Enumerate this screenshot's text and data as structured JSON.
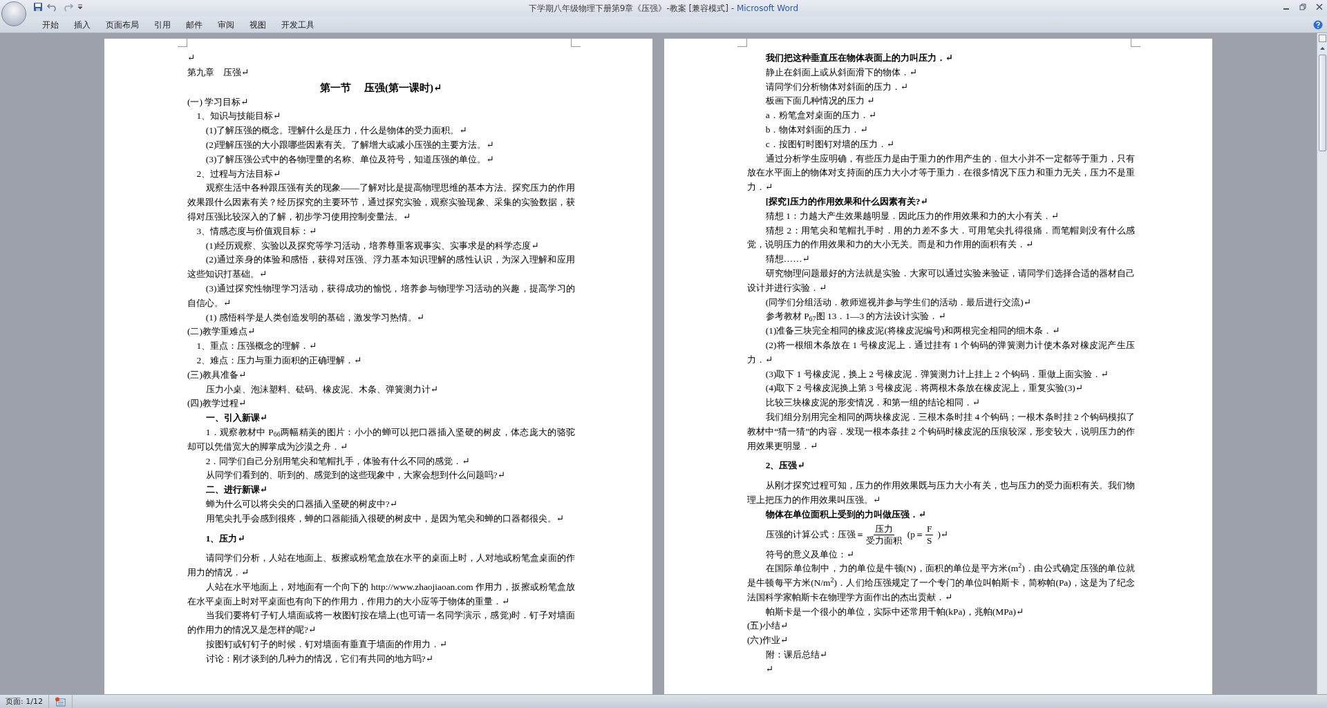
{
  "window": {
    "title": "下学期八年级物理下册第9章《压强》-教案 [兼容模式] - ",
    "app": "Microsoft Word"
  },
  "ribbon_tabs": [
    {
      "label": "开始"
    },
    {
      "label": "插入"
    },
    {
      "label": "页面布局"
    },
    {
      "label": "引用"
    },
    {
      "label": "邮件"
    },
    {
      "label": "审阅"
    },
    {
      "label": "视图"
    },
    {
      "label": "开发工具"
    }
  ],
  "pages": [
    {
      "paragraphs": [
        {
          "kind": "flush",
          "text": "↵"
        },
        {
          "kind": "flush",
          "text": "第九章　压强↵"
        },
        {
          "kind": "title",
          "text": "第一节　 压强(第一课时)↵"
        },
        {
          "kind": "flush",
          "text": "(一) 学习目标↵"
        },
        {
          "kind": "indent1",
          "text": "1、知识与技能目标↵"
        },
        {
          "kind": "indent2",
          "text": "(1)了解压强的概念。理解什么是压力，什么是物体的受力面积。↵"
        },
        {
          "kind": "indent2",
          "text": "(2)理解压强的大小跟哪些因素有关。了解增大或减小压强的主要方法。↵"
        },
        {
          "kind": "indent2",
          "text": "(3)了解压强公式中的各物理量的名称、单位及符号，知道压强的单位。↵"
        },
        {
          "kind": "indent1",
          "text": "2、过程与方法目标↵"
        },
        {
          "kind": "indent2",
          "text": "观察生活中各种跟压强有关的现象——了解对比是提高物理思维的基本方法。探究压力的作用效果跟什么因素有关？经历探究的主要环节，通过探究实验，观察实验现象、采集的实验数据，获得对压强比较深入的了解，初步学习使用控制变量法。↵"
        },
        {
          "kind": "indent1",
          "text": "3、情感态度与价值观目标：↵"
        },
        {
          "kind": "indent2",
          "text": "(1)经历观察、实验以及探究等学习活动，培养尊重客观事实、实事求是的科学态度↵"
        },
        {
          "kind": "indent2",
          "text": "(2)通过亲身的体验和感悟，获得对压强、浮力基本知识理解的感性认识，为深入理解和应用这些知识打基础。↵"
        },
        {
          "kind": "indent2",
          "text": "(3)通过探究性物理学习活动，获得成功的愉悦，培养参与物理学习活动的兴趣，提高学习的自信心。↵"
        },
        {
          "kind": "indent2",
          "text": "(1) 感悟科学是人类创造发明的基础，激发学习热情。↵"
        },
        {
          "kind": "flush",
          "text": "(二)教学重难点↵"
        },
        {
          "kind": "indent1",
          "text": "1、重点：压强概念的理解．↵"
        },
        {
          "kind": "indent1",
          "text": "2、难点：压力与重力面积的正确理解．↵"
        },
        {
          "kind": "flush",
          "text": "(三)教具准备↵"
        },
        {
          "kind": "indent2",
          "text": "压力小桌、泡沫塑料、砝码、橡皮泥、木条、弹簧测力计↵"
        },
        {
          "kind": "flush",
          "text": "(四)教学过程↵"
        },
        {
          "kind": "indent2",
          "bold": true,
          "text": "一、引入新课↵"
        },
        {
          "kind": "indent2",
          "text": "1．观察教材中 P$_{66}$两幅精美的图片：小小的蝉可以把口器插入坚硬的树皮，体态庞大的骆驼却可以凭借宽大的脚掌成为沙漠之舟．↵"
        },
        {
          "kind": "indent2",
          "text": "2．同学们自己分别用笔尖和笔帽扎手，体验有什么不同的感觉．↵"
        },
        {
          "kind": "indent2",
          "text": "从同学们看到的、听到的、感觉到的这些现象中，大家会想到什么问题吗?↵"
        },
        {
          "kind": "indent2",
          "bold": true,
          "text": "二、进行新课↵"
        },
        {
          "kind": "indent2",
          "text": "蝉为什么可以将尖尖的口器插入坚硬的树皮中?↵"
        },
        {
          "kind": "indent2",
          "text": "用笔尖扎手会感到很疼，蝉的口器能插入很硬的树皮中，是因为笔尖和蝉的口器都很尖。↵"
        },
        {
          "kind": "heading",
          "text": "1、压力↵"
        },
        {
          "kind": "indent2",
          "text": "请同学们分析，人站在地面上、板擦或粉笔盒放在水平的桌面上时，人对地或粉笔盒桌面的作用力的情况．↵"
        },
        {
          "kind": "indent2",
          "text": "人站在水平地面上，对地面有一个向下的 http://www.zhaojiaoan.com 作用力，扳擦或粉笔盒放在水平桌面上时对平桌面也有向下的作用力，作用力的大小应等于物体的重量．↵"
        },
        {
          "kind": "indent2",
          "text": "当我们要将钉子钉人墙面或将一枚图钉按在墙上(也可请一名同学演示，感觉)时．钉子对墙面的作用力的情况又是怎样的呢?↵"
        },
        {
          "kind": "indent2",
          "text": "按图钉或钉钉子的时候．钉对墙面有垂直于墙面的作用力．↵"
        },
        {
          "kind": "indent2",
          "text": "讨论：刚才谈到的几种力的情况，它们有共同的地方吗?↵"
        }
      ]
    },
    {
      "paragraphs": [
        {
          "kind": "indent2",
          "bold": true,
          "text": "我们把这种垂直压在物体表面上的力叫压力．↵"
        },
        {
          "kind": "indent2",
          "text": "静止在斜面上或从斜面滑下的物体．↵"
        },
        {
          "kind": "indent2",
          "text": "请同学们分析物体对斜面的压力．↵"
        },
        {
          "kind": "indent2",
          "text": "板画下面几种情况的压力 ↵"
        },
        {
          "kind": "indent2",
          "text": "a．粉笔盒对桌面的压力．↵"
        },
        {
          "kind": "indent2",
          "text": "b．物体对斜面的压力．↵"
        },
        {
          "kind": "indent2",
          "text": "c．按图钉时图钉对墙的压力．↵"
        },
        {
          "kind": "indent2",
          "text": "通过分析学生应明确，有些压力是由于重力的作用产生的．但大小并不一定都等于重力，只有放在水平面上的物体对支持面的压力大小才等于重力．在很多情况下压力和重力无关，压力不是重力．↵"
        },
        {
          "kind": "indent2",
          "bold": true,
          "text": "[探究]压力的作用效果和什么因素有关?↵"
        },
        {
          "kind": "indent2",
          "text": "猜想 1：力越大产生效果越明显．因此压力的作用效果和力的大小有关．↵"
        },
        {
          "kind": "indent2",
          "text": "猜想 2：用笔尖和笔帽扎手时．用的力差不多大．可用笔尖扎得很痛．而笔帽则没有什么感觉，说明压力的作用效果和力的大小无关。而是和力作用的面积有关．↵"
        },
        {
          "kind": "indent2",
          "text": "猜想……↵"
        },
        {
          "kind": "indent2",
          "text": "研究物理问题最好的方法就是实验．大家可以通过实验来验证，请同学们选择合适的器材自己设计并进行实验．↵"
        },
        {
          "kind": "indent2",
          "text": "(同学们分组活动．教师巡视并参与学生们的活动．最后进行交流)↵"
        },
        {
          "kind": "indent2",
          "text": "参考教材 P$_{67}$图 13．1—3 的方法设计实验．↵"
        },
        {
          "kind": "indent2",
          "text": "(1)准备三块完全相同的橡皮泥(将橡皮泥编号)和两根完全相同的细木条．↵"
        },
        {
          "kind": "indent2",
          "text": "(2)将一根细木条放在 1 号橡皮泥上．通过挂有 1 个钩码的弹簧测力计使木条对橡皮泥产生压力．↵"
        },
        {
          "kind": "indent2",
          "text": "(3)取下 1 号橡皮泥，换上 2 号橡皮泥．弹簧测力计上挂上 2 个钩码．重做上面实验．↵"
        },
        {
          "kind": "indent2",
          "text": "(4)取下 2 号橡皮泥换上第 3 号橡皮泥．将两根木条放在橡皮泥上，重复实验(3)↵"
        },
        {
          "kind": "indent2",
          "text": "比较三块橡皮泥的形变情况．和第一组的结论相同．↵"
        },
        {
          "kind": "indent2",
          "text": "我们组分别用完全相同的两块橡皮泥．三根木条时挂 4 个钩码；一根木条时挂 2 个钩码模拟了教材中“猜一猜”的内容．发现一根本条挂 2 个钩码时橡皮泥的压痕较深，形变较大，说明压力的作用效果更明显．↵"
        },
        {
          "kind": "heading",
          "text": "2、压强↵"
        },
        {
          "kind": "indent2",
          "text": "从刚才探究过程可知，压力的作用效果既与压力大小有关，也与压力的受力面积有关。我们物理上把压力的作用效果叫压强。↵"
        },
        {
          "kind": "indent2",
          "bold": true,
          "text": "物体在单位面积上受到的力叫做压强．↵"
        },
        {
          "kind": "formula",
          "lead": "压强的计算公式：压强＝",
          "numerator": "压力",
          "denominator": "受力面积",
          "open": "(p＝",
          "numerator_2": "F",
          "denominator_2": "S",
          "close": ")↵"
        },
        {
          "kind": "indent2",
          "text": "符号的意义及单位：↵"
        },
        {
          "kind": "indent2",
          "text": "在国际单位制中，力的单位是牛顿(N)，面积的单位是平方米(m$^{2}$)．由公式确定压强的单位就是牛顿每平方米(N/m$^{2}$)．人们给压强规定了一个专门的单位叫帕斯卡，简称帕(Pa)，这是为了纪念法国科学家帕斯卡在物理学方面作出的杰出贡献．↵"
        },
        {
          "kind": "indent2",
          "text": "帕斯卡是一个很小的单位，实际中还常用千帕(kPa)，兆帕(MPa)↵"
        },
        {
          "kind": "flush",
          "text": "(五)小结↵"
        },
        {
          "kind": "flush",
          "text": "(六)作业↵"
        },
        {
          "kind": "indent2",
          "text": "附：课后总结↵"
        },
        {
          "kind": "indent2",
          "text": "↵"
        }
      ]
    }
  ],
  "status_bar": {
    "page": "页面: 1/12"
  }
}
